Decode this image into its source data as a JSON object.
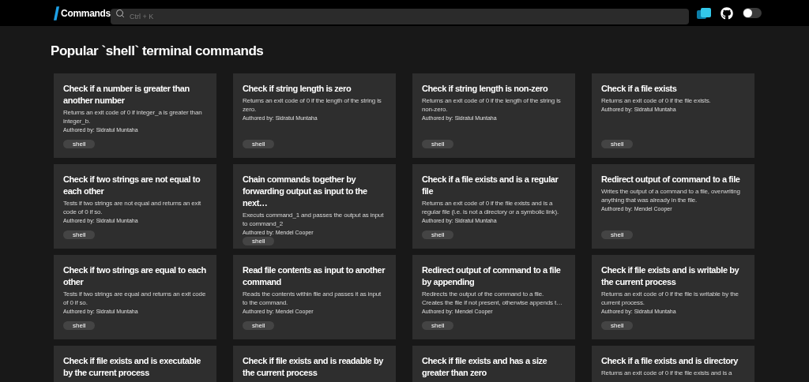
{
  "header": {
    "logo_text": "Commands",
    "search": {
      "placeholder": "Ctrl + K"
    },
    "theme_toggle": {
      "on": false
    }
  },
  "page_title": "Popular `shell` terminal commands",
  "cards": [
    {
      "title": "Check if a number is greater than another number",
      "description": "Returns an exit code of 0 if integer_a is greater than integer_b.",
      "author": "Authored by: Sidratul Muntaha",
      "tag": "shell"
    },
    {
      "title": "Check if string length is zero",
      "description": "Returns an exit code of 0 if the length of the string is zero.",
      "author": "Authored by: Sidratul Muntaha",
      "tag": "shell"
    },
    {
      "title": "Check if string length is non-zero",
      "description": "Returns an exit code of 0 if the length of the string is non-zero.",
      "author": "Authored by: Sidratul Muntaha",
      "tag": "shell"
    },
    {
      "title": "Check if a file exists",
      "description": "Returns an exit code of 0 if the file exists.",
      "author": "Authored by: Sidratul Muntaha",
      "tag": "shell"
    },
    {
      "title": "Check if two strings are not equal to each other",
      "description": "Tests if two strings are not equal and returns an exit code of 0 if so.",
      "author": "Authored by: Sidratul Muntaha",
      "tag": "shell"
    },
    {
      "title": "Chain commands together by forwarding output as input to the next…",
      "description": "Executs command_1 and passes the output as input to command_2",
      "author": "Authored by: Mendel Cooper",
      "tag": "shell"
    },
    {
      "title": "Check if a file exists and is a regular file",
      "description": "Returns an exit code of 0 if the file exists and is a regular file (i.e. is not a directory or a symbolic link).",
      "author": "Authored by: Sidratul Muntaha",
      "tag": "shell"
    },
    {
      "title": "Redirect output of command to a file",
      "description": "Writes the output of a command to a file, overwriting anything that was already in the file.",
      "author": "Authored by: Mendel Cooper",
      "tag": "shell"
    },
    {
      "title": "Check if two strings are equal to each other",
      "description": "Tests if two strings are equal and returns an exit code of 0 if so.",
      "author": "Authored by: Sidratul Muntaha",
      "tag": "shell"
    },
    {
      "title": "Read file contents as input to another command",
      "description": "Reads the contents within file and passes it as input to the command.",
      "author": "Authored by: Mendel Cooper",
      "tag": "shell"
    },
    {
      "title": "Redirect output of command to a file by appending",
      "description": "Redirects the output of the command to a file. Creates the file if not present, otherwise appends t…",
      "author": "Authored by: Mendel Cooper",
      "tag": "shell"
    },
    {
      "title": "Check if file exists and is writable by the current process",
      "description": "Returns an exit code of 0 if the file is writable by the current process.",
      "author": "Authored by: Sidratul Muntaha",
      "tag": "shell"
    },
    {
      "title": "Check if file exists and is executable by the current process"
    },
    {
      "title": "Check if file exists and is readable by the current process"
    },
    {
      "title": "Check if file exists and has a size greater than zero"
    },
    {
      "title": "Check if a file exists and is directory",
      "description": "Returns an exit code of 0 if the file exists and is a"
    }
  ]
}
